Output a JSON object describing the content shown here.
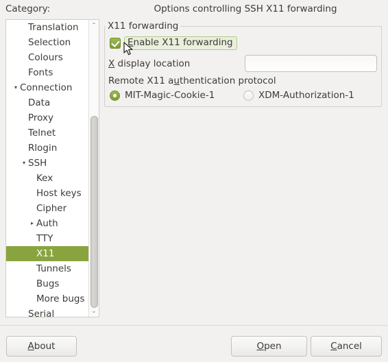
{
  "window": {
    "category_label": "Category:",
    "panel_title": "Options controlling SSH X11 forwarding"
  },
  "sidebar": {
    "items": [
      {
        "label": "Translation",
        "level": 1,
        "expander": "",
        "selected": false
      },
      {
        "label": "Selection",
        "level": 1,
        "expander": "",
        "selected": false
      },
      {
        "label": "Colours",
        "level": 1,
        "expander": "",
        "selected": false
      },
      {
        "label": "Fonts",
        "level": 1,
        "expander": "",
        "selected": false
      },
      {
        "label": "Connection",
        "level": 0,
        "expander": "▾",
        "selected": false
      },
      {
        "label": "Data",
        "level": 1,
        "expander": "",
        "selected": false
      },
      {
        "label": "Proxy",
        "level": 1,
        "expander": "",
        "selected": false
      },
      {
        "label": "Telnet",
        "level": 1,
        "expander": "",
        "selected": false
      },
      {
        "label": "Rlogin",
        "level": 1,
        "expander": "",
        "selected": false
      },
      {
        "label": "SSH",
        "level": 1,
        "expander": "▾",
        "selected": false
      },
      {
        "label": "Kex",
        "level": 2,
        "expander": "",
        "selected": false
      },
      {
        "label": "Host keys",
        "level": 2,
        "expander": "",
        "selected": false
      },
      {
        "label": "Cipher",
        "level": 2,
        "expander": "",
        "selected": false
      },
      {
        "label": "Auth",
        "level": 2,
        "expander": "▸",
        "selected": false
      },
      {
        "label": "TTY",
        "level": 2,
        "expander": "",
        "selected": false
      },
      {
        "label": "X11",
        "level": 2,
        "expander": "",
        "selected": true
      },
      {
        "label": "Tunnels",
        "level": 2,
        "expander": "",
        "selected": false
      },
      {
        "label": "Bugs",
        "level": 2,
        "expander": "",
        "selected": false
      },
      {
        "label": "More bugs",
        "level": 2,
        "expander": "",
        "selected": false
      },
      {
        "label": "Serial",
        "level": 1,
        "expander": "",
        "selected": false
      }
    ],
    "scrollbar": {
      "up_arrow": "⌃",
      "down_arrow": "⌄"
    },
    "selection_color": "#89a43e"
  },
  "main": {
    "group_title": "X11 forwarding",
    "enable_checkbox": {
      "label_prefix": "",
      "mnemonic": "E",
      "label_rest": "nable X11 forwarding",
      "checked": true,
      "focused": true
    },
    "x_display": {
      "mnemonic": "X",
      "label_rest": " display location",
      "value": "",
      "placeholder": ""
    },
    "auth_protocol": {
      "label_part1": "Remote X11 a",
      "mnemonic": "u",
      "label_part2": "thentication protocol",
      "options": [
        {
          "label": "MIT-Magic-Cookie-1",
          "selected": true
        },
        {
          "label": "XDM-Authorization-1",
          "selected": false
        }
      ]
    }
  },
  "footer": {
    "about": {
      "mnemonic": "A",
      "rest": "bout"
    },
    "open": {
      "mnemonic": "O",
      "rest": "pen"
    },
    "cancel": {
      "mnemonic": "C",
      "rest": "ancel"
    }
  }
}
